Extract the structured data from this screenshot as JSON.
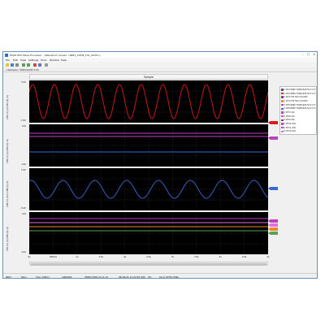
{
  "window": {
    "title": "HIOKI 8S5 Wave Processor - [Waveform Screen <8847_CODE_FUL_S035>]",
    "controls": [
      "–",
      "□",
      "✕"
    ]
  },
  "menu": [
    "File",
    "Edit",
    "View",
    "Settings",
    "Tools",
    "Window",
    "Help"
  ],
  "toolbar2": {
    "label": "<Sample> 500ms/DIV  0.5s"
  },
  "sample_bar": {
    "label": "Sample"
  },
  "colors": {
    "red": "#e0191b",
    "blue": "#3a68d6",
    "magenta": "#c03fc0",
    "orange": "#f08a1d",
    "grid": "#3a3a3a"
  },
  "panels": [
    {
      "label": "CH1 [1] (V) CH2 [2] (V)",
      "top_value": "5.0V",
      "bottom_value": "-5.0V",
      "marker": "1"
    },
    {
      "label": "CH3 [1] (A) CH4 [1] (A)",
      "top_value": "10A",
      "bottom_value": "-10A",
      "marker": "3"
    },
    {
      "label": "CH5 [1] (mV) CH6 [1] (V)",
      "top_value": "5.0V",
      "bottom_value": "-5.0V",
      "marker": "5"
    },
    {
      "label": "CH7 [2] (A) CH8 [2] (A)",
      "top_value": "10A",
      "bottom_value": "-10A",
      "marker": "7"
    }
  ],
  "legend": [
    {
      "color": "#3b4ea0",
      "text": "1 CH1 8966 TODZ1426 5mV 0.5V"
    },
    {
      "color": "#e0191b",
      "text": "1 CH2 8966 TODZ1426 5mV 0.5V"
    },
    {
      "color": "#7a3c9a",
      "text": "2 CH3 CT6 50A 0.5A/DIV"
    },
    {
      "color": "#f08a1d",
      "text": "2 CH4 CT6 50A 0.5A/DIV"
    },
    {
      "color": "#c03fc0",
      "text": "3 CH5 8966 TODZ1426 5mV 0.5V"
    },
    {
      "color": "#3a68d6",
      "text": "3 CH6 8966 TODZ1426 5mV 0.5V"
    },
    {
      "color": "#c03fc0",
      "text": "4 CH7 LOG"
    },
    {
      "color": "#d04fd0",
      "text": "4 CH8 LOG"
    },
    {
      "color": "#8a2b8a",
      "text": "5 CH9 LOG"
    },
    {
      "color": "#c03fc0",
      "text": "5 CH10 LOG"
    },
    {
      "color": "#b04fb0",
      "text": "6 CH11 LOG"
    },
    {
      "color": "#e070e0",
      "text": "6 CH12 LOG"
    }
  ],
  "xaxis": [
    "0s",
    "500ms",
    "1s",
    "1.5s",
    "2s",
    "2.5s",
    "3s",
    "3.5s",
    "4s",
    "4.5s",
    "5s"
  ],
  "markers_right": [
    {
      "label": "1",
      "color": "#e0191b"
    },
    {
      "label": "3",
      "color": "#c03fc0"
    },
    {
      "label": "5",
      "color": "#3a68d6"
    },
    {
      "label": "7",
      "color": "#c03fc0"
    }
  ],
  "statusbar": {
    "left": "8847",
    "b": "Main",
    "c": "5ms (200/s)",
    "d": "1000000",
    "e": "5F665.558s at 11:13",
    "f": "08-09-05 11:24:55.409",
    "g": "0%",
    "h": "0s to 5/H70.558s"
  },
  "chart_data": [
    {
      "type": "line",
      "x": [
        0,
        5
      ],
      "series": [
        {
          "color": "#e0191b",
          "values": []
        }
      ],
      "xlabel": "",
      "ylim": [
        -5,
        5
      ],
      "cycles": 11
    },
    {
      "type": "line",
      "x": [
        0,
        5
      ],
      "series": [
        {
          "color": "#3a68d6",
          "values": []
        }
      ],
      "xlabel": "",
      "ylim": [
        -5,
        5
      ],
      "cycles": 7.5
    }
  ]
}
